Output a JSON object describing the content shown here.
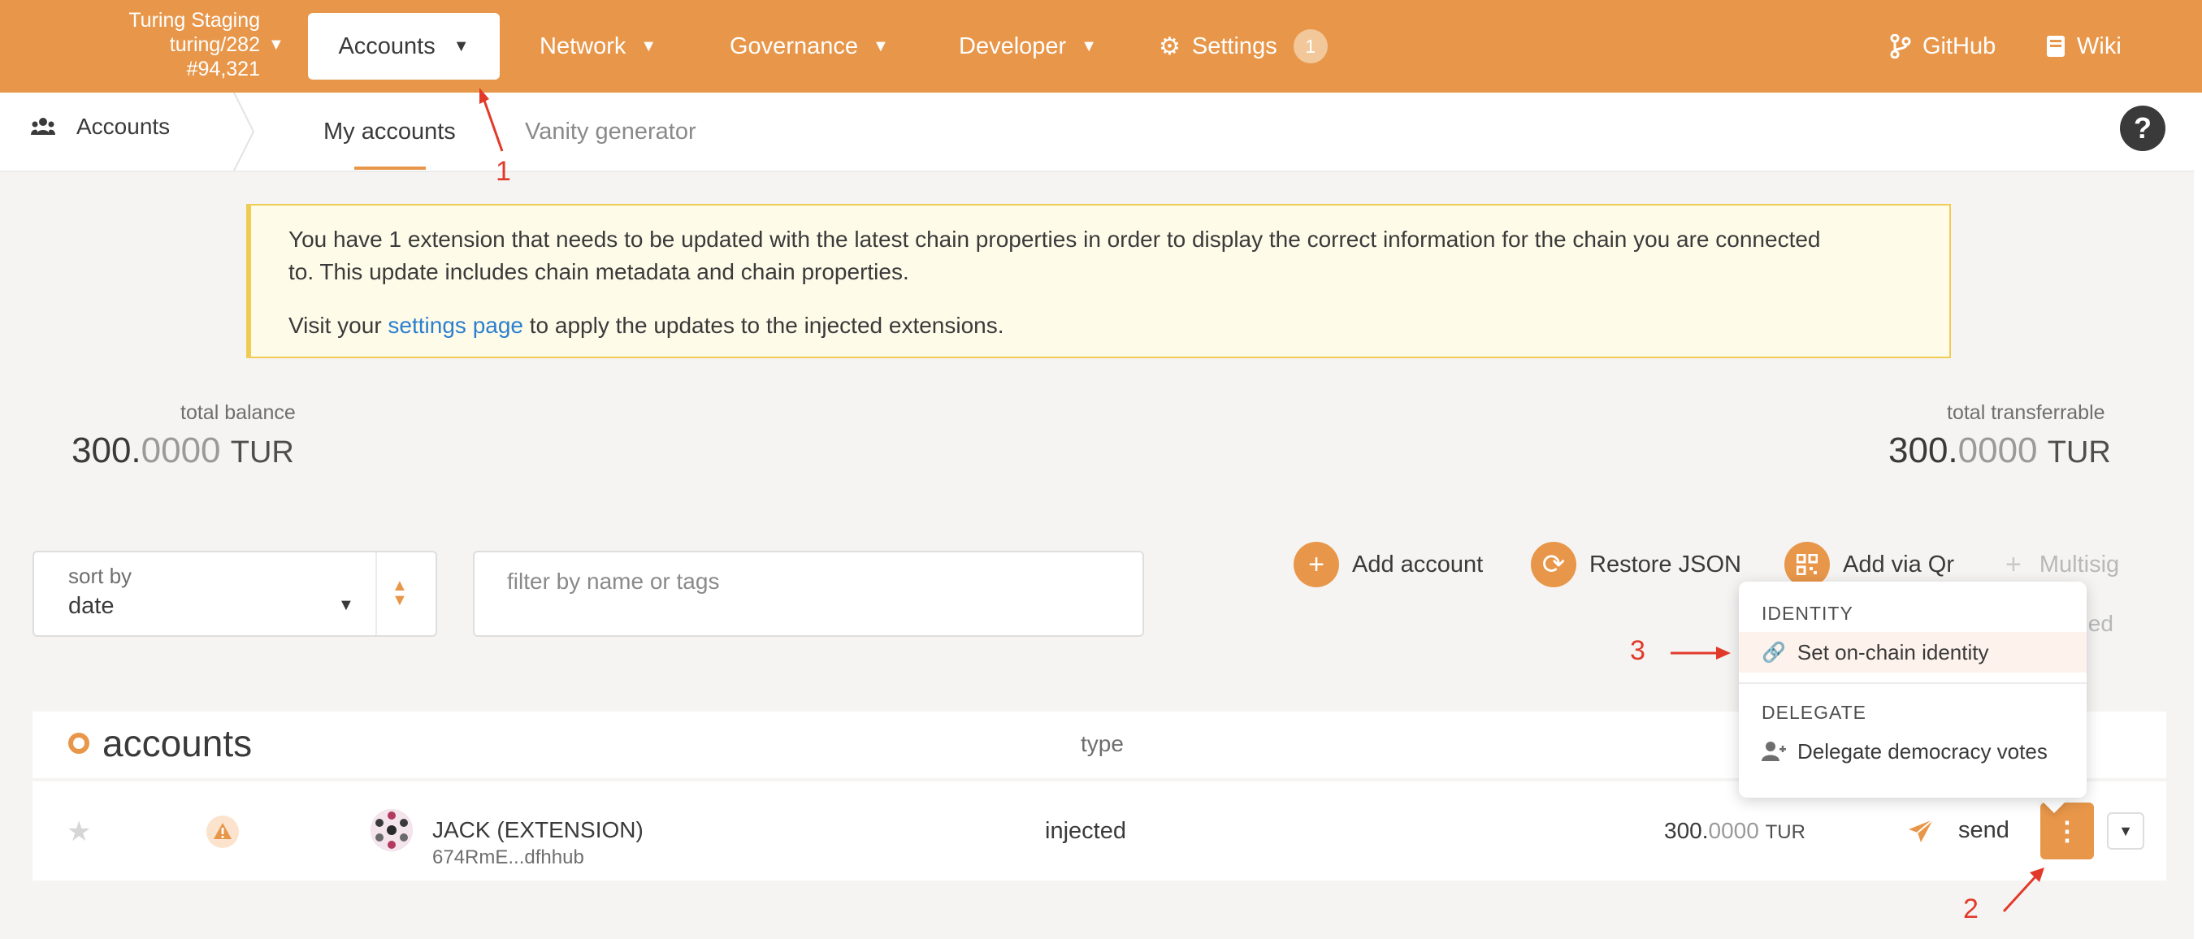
{
  "topbar": {
    "chain": [
      "Turing Staging",
      "turing/282",
      "#94,321"
    ],
    "nav": [
      {
        "label": "Accounts"
      },
      {
        "label": "Network"
      },
      {
        "label": "Governance"
      },
      {
        "label": "Developer"
      },
      {
        "label": "Settings",
        "badge": "1"
      }
    ],
    "right_links": [
      {
        "label": "GitHub"
      },
      {
        "label": "Wiki"
      }
    ],
    "accent": "#e8974a"
  },
  "subnav": {
    "section": "Accounts",
    "tabs": [
      {
        "label": "My accounts",
        "active": true
      },
      {
        "label": "Vanity generator"
      }
    ],
    "help": "?"
  },
  "notice": {
    "line1": "You have 1 extension that needs to be updated with the latest chain properties in order to display the correct information for the chain you are connected",
    "line2": "to. This update includes chain metadata and chain properties.",
    "line3_pre": "Visit your",
    "line3_link": "settings page",
    "line3_post": "to apply the updates to the injected extensions."
  },
  "balances": {
    "total_balance": {
      "label": "total balance",
      "int": "300.",
      "frac": "0000",
      "unit": "TUR"
    },
    "total_transferrable": {
      "label": "total transferrable",
      "int": "300.",
      "frac": "0000",
      "unit": "TUR"
    }
  },
  "controls": {
    "sort_label": "sort by",
    "sort_value": "date",
    "filter_placeholder": "filter by name or tags",
    "actions": [
      {
        "label": "Add account",
        "icon": "plus-icon"
      },
      {
        "label": "Restore JSON",
        "icon": "sync-icon"
      },
      {
        "label": "Add via Qr",
        "icon": "qrcode-icon"
      },
      {
        "label": "Multisig",
        "icon": "plus-icon",
        "disabled": true
      }
    ],
    "proxied_partial": "oxied"
  },
  "table": {
    "title": "accounts",
    "type_header": "type",
    "rows": [
      {
        "name": "JACK (EXTENSION)",
        "address": "674RmE...dfhhub",
        "type": "injected",
        "balance_int": "300.",
        "balance_frac": "0000",
        "balance_unit": "TUR",
        "send": "send"
      }
    ]
  },
  "menu": {
    "identity_header": "IDENTITY",
    "identity_item": "Set on-chain identity",
    "delegate_header": "DELEGATE",
    "delegate_item": "Delegate democracy votes"
  },
  "annotations": [
    "1",
    "2",
    "3"
  ]
}
